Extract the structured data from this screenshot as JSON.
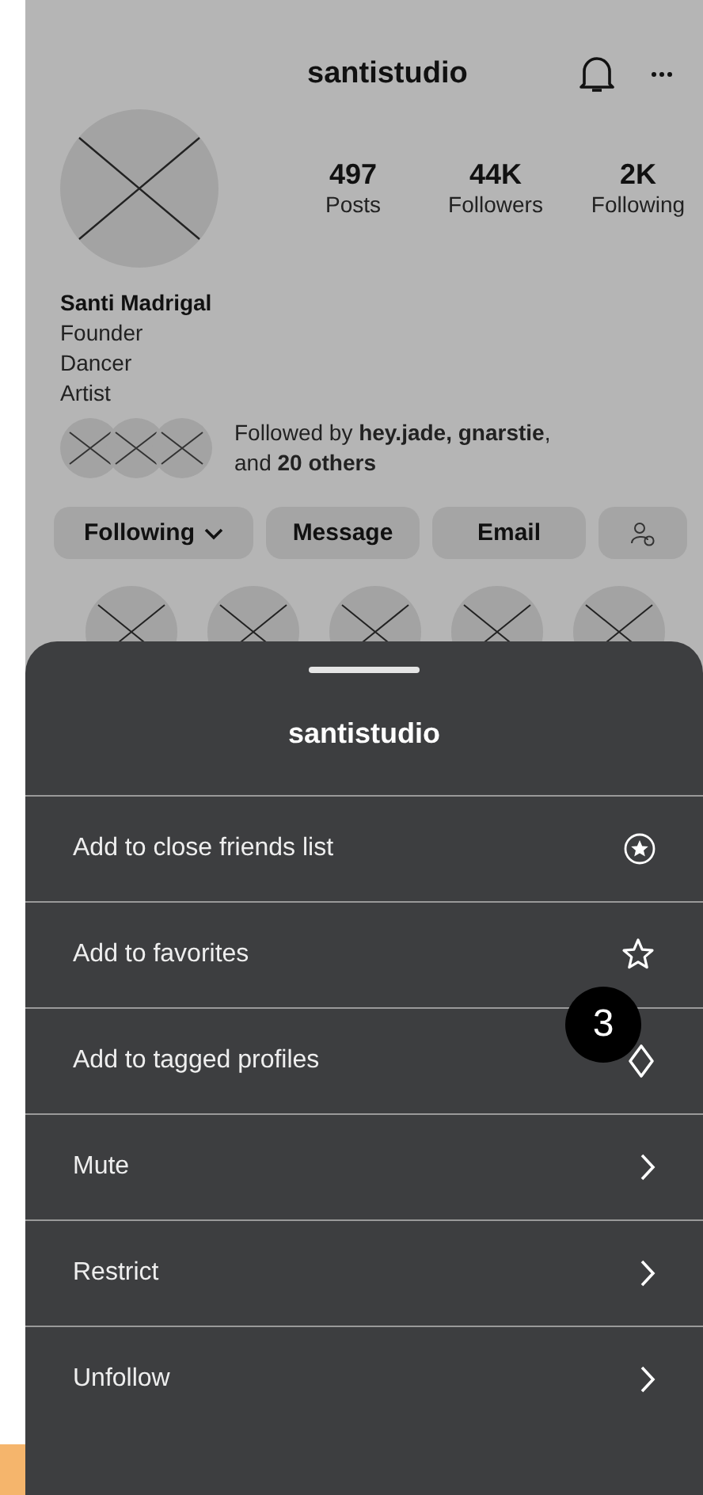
{
  "profile": {
    "username": "santistudio",
    "stats": [
      {
        "value": "497",
        "label": "Posts"
      },
      {
        "value": "44K",
        "label": "Followers"
      },
      {
        "value": "2K",
        "label": "Following"
      }
    ],
    "name": "Santi Madrigal",
    "bio": [
      "Founder",
      "Dancer",
      "Artist"
    ],
    "followed_by": "Followed by **hey.jade, gnarstie**, and **20 others**",
    "buttons": [
      {
        "kind": "dropdown",
        "label": "Following"
      },
      {
        "kind": "text",
        "label": "Message"
      },
      {
        "kind": "text",
        "label": "Email"
      },
      {
        "kind": "icon"
      }
    ]
  },
  "sheet": {
    "title": "santistudio",
    "options": [
      {
        "label": "Add to close friends list",
        "kind": "close_friends"
      },
      {
        "label": "Add to favorites",
        "kind": "favorite"
      },
      {
        "label": "Add to tagged profiles",
        "kind": "tagged"
      },
      {
        "label": "Mute",
        "kind": "submenu"
      },
      {
        "label": "Restrict",
        "kind": "submenu"
      },
      {
        "label": "Unfollow",
        "kind": "submenu"
      }
    ]
  },
  "step_badge": "3"
}
